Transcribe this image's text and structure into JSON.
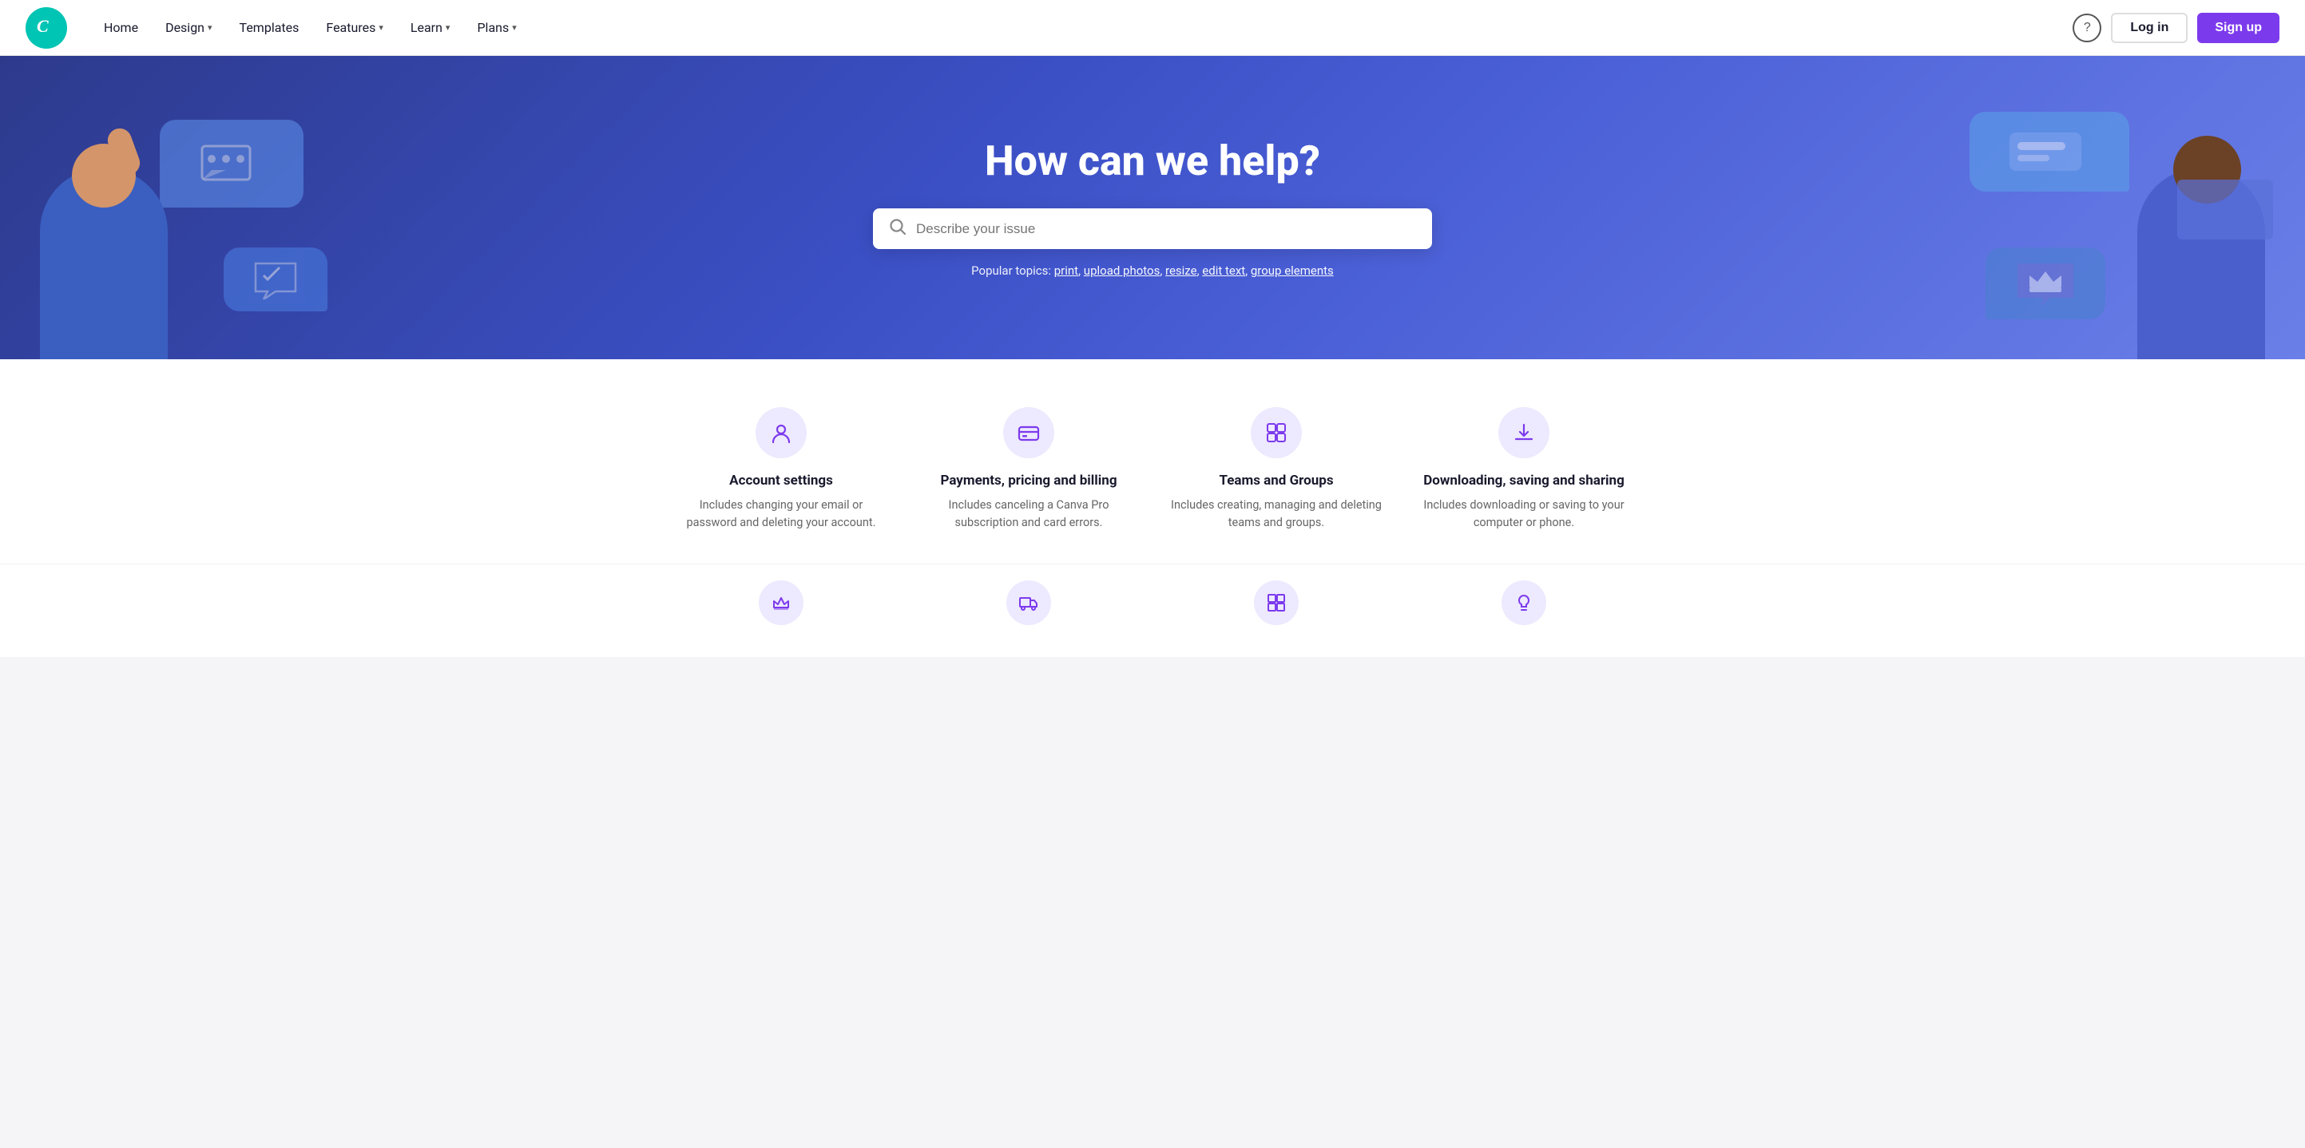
{
  "nav": {
    "logo_text": "Canva",
    "links": [
      {
        "label": "Home",
        "has_dropdown": false
      },
      {
        "label": "Design",
        "has_dropdown": true
      },
      {
        "label": "Templates",
        "has_dropdown": false
      },
      {
        "label": "Features",
        "has_dropdown": true
      },
      {
        "label": "Learn",
        "has_dropdown": true
      },
      {
        "label": "Plans",
        "has_dropdown": true
      }
    ],
    "help_icon": "?",
    "login_label": "Log in",
    "signup_label": "Sign up"
  },
  "hero": {
    "title": "How can we help?",
    "search_placeholder": "Describe your issue",
    "popular_label": "Popular topics:",
    "popular_topics": [
      {
        "label": "print",
        "href": "#"
      },
      {
        "label": "upload photos",
        "href": "#"
      },
      {
        "label": "resize",
        "href": "#"
      },
      {
        "label": "edit text",
        "href": "#"
      },
      {
        "label": "group elements",
        "href": "#"
      }
    ]
  },
  "categories": [
    {
      "icon": "account",
      "title": "Account settings",
      "desc": "Includes changing your email or password and deleting your account."
    },
    {
      "icon": "billing",
      "title": "Payments, pricing and billing",
      "desc": "Includes canceling a Canva Pro subscription and card errors."
    },
    {
      "icon": "teams",
      "title": "Teams and Groups",
      "desc": "Includes creating, managing and deleting teams and groups."
    },
    {
      "icon": "download",
      "title": "Downloading, saving and sharing",
      "desc": "Includes downloading or saving to your computer or phone."
    }
  ],
  "categories_bottom": [
    {
      "icon": "crown"
    },
    {
      "icon": "truck"
    },
    {
      "icon": "grid"
    },
    {
      "icon": "lightbulb"
    }
  ]
}
